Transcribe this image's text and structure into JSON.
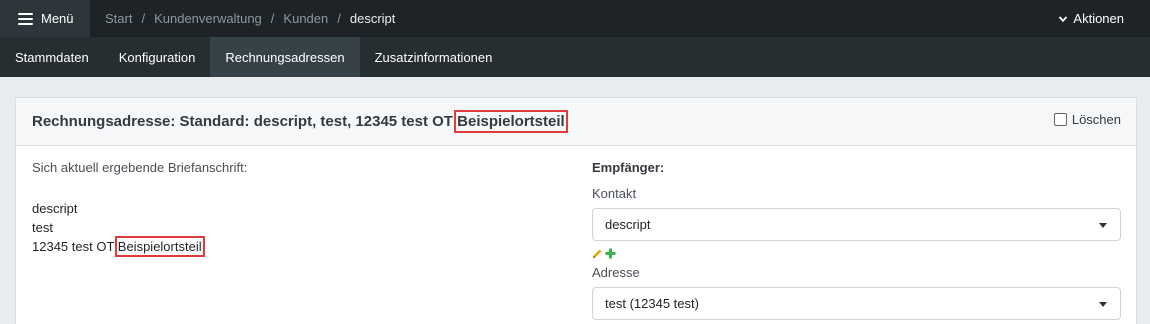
{
  "topbar": {
    "menu_label": "Menü",
    "breadcrumb": [
      "Start",
      "Kundenverwaltung",
      "Kunden",
      "descript"
    ],
    "actions_label": "Aktionen"
  },
  "tabs": [
    {
      "label": "Stammdaten",
      "active": false
    },
    {
      "label": "Konfiguration",
      "active": false
    },
    {
      "label": "Rechnungsadressen",
      "active": true
    },
    {
      "label": "Zusatzinformationen",
      "active": false
    }
  ],
  "card": {
    "title_prefix": "Rechnungsadresse: Standard: descript, test, 12345 test OT",
    "title_highlight": "Beispielortsteil",
    "delete_label": "Löschen",
    "letter_heading": "Sich aktuell ergebende Briefanschrift:",
    "address_lines": [
      "descript",
      "test"
    ],
    "address_city": "12345 test OT",
    "address_highlight": "Beispielortsteil",
    "recipient_title": "Empfänger:",
    "contact_label": "Kontakt",
    "contact_value": "descript",
    "address_label": "Adresse",
    "address_value": "test (12345 test)"
  },
  "colors": {
    "topbar": "#1d2326",
    "tabbar": "#262e32",
    "tab_active": "#364247",
    "highlight": "#e23b3b",
    "pencil": "#e0a800",
    "plus": "#3db34a"
  },
  "icons": [
    "hamburger-icon",
    "chevron-down-icon",
    "pencil-icon",
    "plus-icon",
    "caret-down-icon"
  ]
}
